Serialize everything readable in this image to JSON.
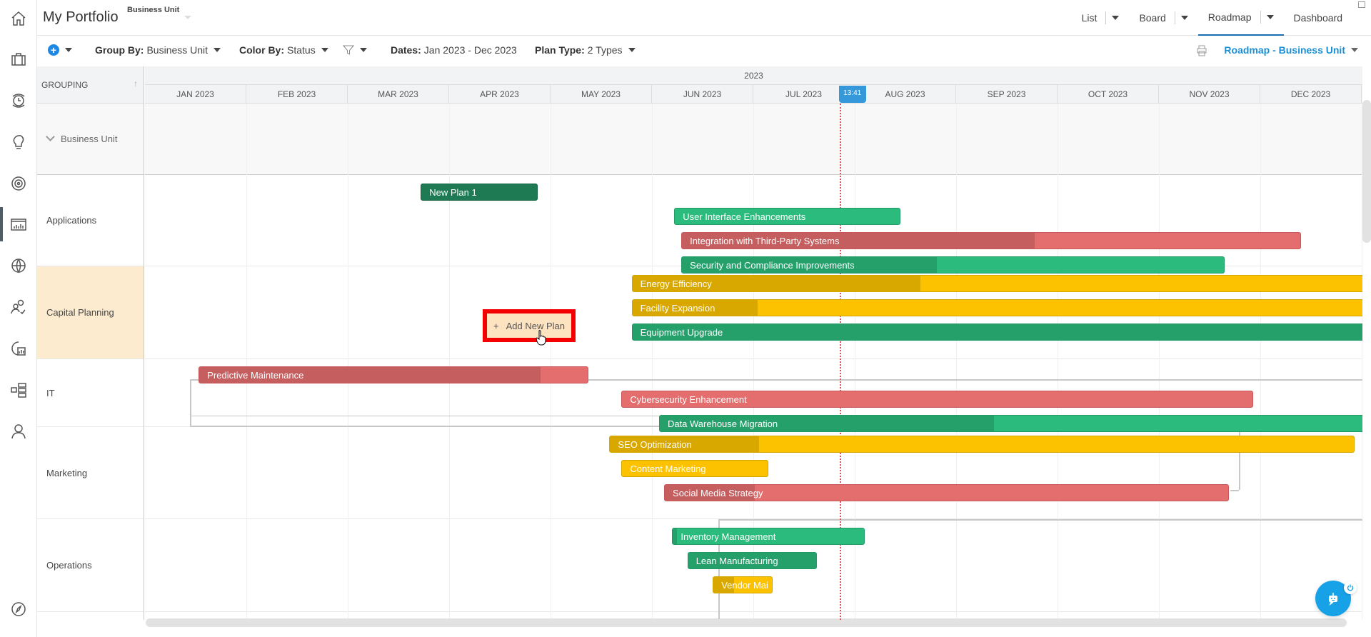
{
  "sidebar": {
    "items": [
      {
        "name": "home-icon"
      },
      {
        "name": "briefcase-icon"
      },
      {
        "name": "timesheet-icon"
      },
      {
        "name": "lightbulb-icon"
      },
      {
        "name": "target-icon"
      },
      {
        "name": "roadmap-chart-icon",
        "active": true
      },
      {
        "name": "globe-icon"
      },
      {
        "name": "team-icon"
      },
      {
        "name": "report-icon"
      },
      {
        "name": "hierarchy-icon"
      },
      {
        "name": "user-icon"
      },
      {
        "name": "compass-icon"
      }
    ]
  },
  "header": {
    "title": "My Portfolio",
    "subtitle": "Business Unit",
    "tabs": [
      {
        "label": "List",
        "has_menu": true
      },
      {
        "label": "Board",
        "has_menu": true
      },
      {
        "label": "Roadmap",
        "has_menu": true,
        "active": true
      },
      {
        "label": "Dashboard",
        "has_menu": false
      }
    ]
  },
  "toolbar": {
    "group_by_label": "Group By:",
    "group_by_value": "Business Unit",
    "color_by_label": "Color By:",
    "color_by_value": "Status",
    "dates_label": "Dates:",
    "dates_value": "Jan 2023 - Dec 2023",
    "plan_type_label": "Plan Type:",
    "plan_type_value": "2 Types",
    "view_name": "Roadmap - Business Unit"
  },
  "timeline": {
    "grouping_header": "GROUPING",
    "year": "2023",
    "months": [
      "JAN 2023",
      "FEB 2023",
      "MAR 2023",
      "APR 2023",
      "MAY 2023",
      "JUN 2023",
      "JUL 2023",
      "AUG 2023",
      "SEP 2023",
      "OCT 2023",
      "NOV 2023",
      "DEC 2023"
    ],
    "today_label": "13:41",
    "today_month_pos": 6.85,
    "group_header": "Business Unit"
  },
  "status_colors": {
    "on_track": "#2bbb7d",
    "at_risk": "#fcc200",
    "off_track": "#e46e6e",
    "new": "#1d7a52"
  },
  "groups": [
    {
      "label": "Applications",
      "plans": [
        {
          "name": "New Plan 1",
          "status": "dkgreen",
          "start": 2.72,
          "end": 3.87,
          "progress": 0
        },
        {
          "name": "User Interface Enhancements",
          "status": "green",
          "start": 5.22,
          "end": 7.45,
          "progress": 0
        },
        {
          "name": "Integration with Third-Party Systems",
          "status": "red",
          "start": 5.29,
          "end": 11.4,
          "progress": 0.57
        },
        {
          "name": "Security and Compliance Improvements",
          "status": "green",
          "start": 5.29,
          "end": 10.65,
          "progress": 0.47
        }
      ]
    },
    {
      "label": "Capital Planning",
      "highlighted": true,
      "plans": [
        {
          "name": "Energy Efficiency",
          "status": "yellow",
          "start": 4.8,
          "end": 12.1,
          "progress": 0.39
        },
        {
          "name": "Facility Expansion",
          "status": "yellow",
          "start": 4.8,
          "end": 12.1,
          "progress": 0.17
        },
        {
          "name": "Equipment Upgrade",
          "status": "green",
          "start": 4.8,
          "end": 12.1,
          "progress": 1
        }
      ]
    },
    {
      "label": "IT",
      "plans": [
        {
          "name": "Predictive Maintenance",
          "status": "red",
          "start": 0.53,
          "end": 4.37,
          "progress": 0.88
        },
        {
          "name": "Cybersecurity Enhancement",
          "status": "red",
          "start": 4.7,
          "end": 10.93,
          "progress": 0
        },
        {
          "name": "Data Warehouse Migration",
          "status": "green",
          "start": 5.07,
          "end": 12.1,
          "progress": 0.47
        }
      ]
    },
    {
      "label": "Marketing",
      "plans": [
        {
          "name": "SEO Optimization",
          "status": "yellow",
          "start": 4.58,
          "end": 11.93,
          "progress": 0.2
        },
        {
          "name": "Content Marketing",
          "status": "yellow",
          "start": 4.7,
          "end": 6.15,
          "progress": 0
        },
        {
          "name": "Social Media Strategy",
          "status": "red",
          "start": 5.12,
          "end": 10.69,
          "progress": 0.16
        }
      ]
    },
    {
      "label": "Operations",
      "plans": [
        {
          "name": "Inventory Management",
          "status": "green",
          "start": 5.2,
          "end": 7.1,
          "progress": 0.02
        },
        {
          "name": "Lean Manufacturing",
          "status": "green",
          "start": 5.35,
          "end": 6.63,
          "progress": 1
        },
        {
          "name": "Vendor Mai",
          "status": "yellow",
          "start": 5.6,
          "end": 6.19,
          "progress": 0.35
        }
      ]
    }
  ],
  "add_plan": {
    "label": "Add New Plan"
  }
}
